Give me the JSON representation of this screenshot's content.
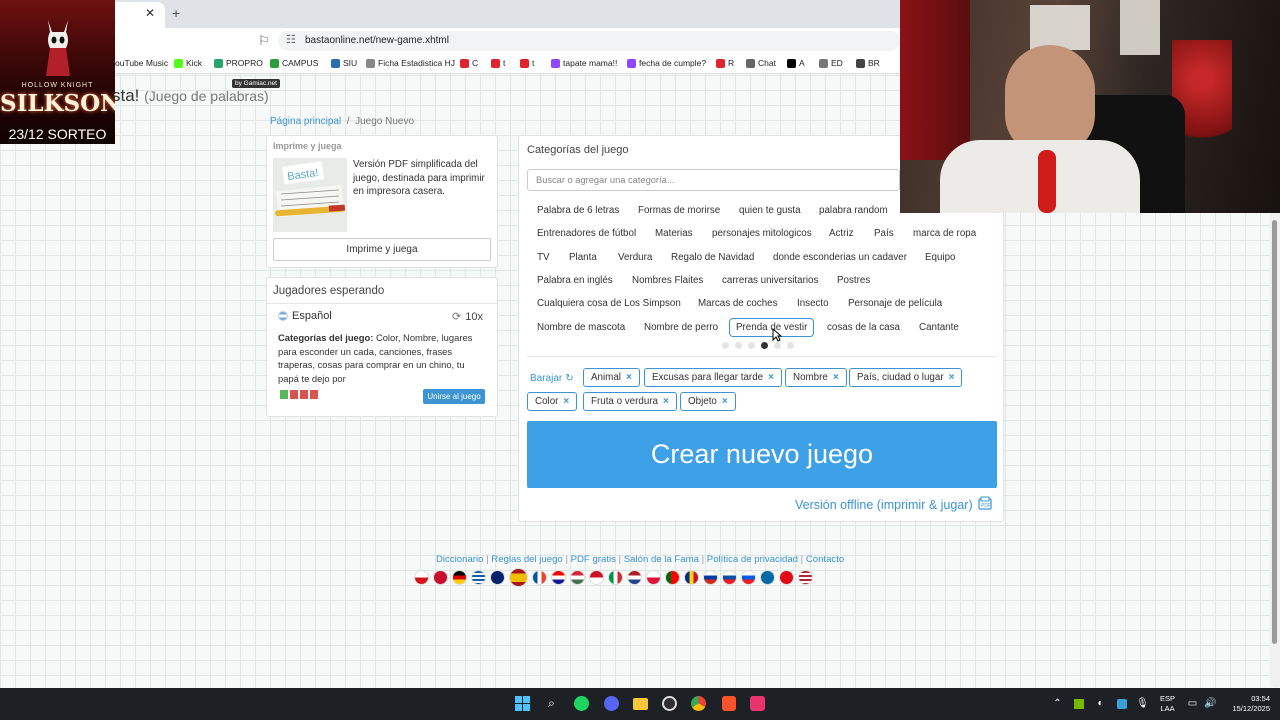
{
  "browser": {
    "url": "bastaonline.net/new-game.xhtml",
    "bookmarks": [
      {
        "label": "ouTube Music",
        "color": "#ff0000"
      },
      {
        "label": "Kick",
        "color": "#53fc18"
      },
      {
        "label": "PROPRO",
        "color": "#2aa56a"
      },
      {
        "label": "CAMPUS",
        "color": "#2e9b3b"
      },
      {
        "label": "SIU",
        "color": "#2d6cb5"
      },
      {
        "label": "Ficha Estadistica HJ",
        "color": "#888888"
      },
      {
        "label": "C",
        "color": "#e0242b"
      },
      {
        "label": "t",
        "color": "#e0242b"
      },
      {
        "label": "t",
        "color": "#e0242b"
      },
      {
        "label": "tapate mama!!",
        "color": "#9146ff"
      },
      {
        "label": "fecha de cumple?",
        "color": "#9146ff"
      },
      {
        "label": "R",
        "color": "#e0242b"
      },
      {
        "label": "Chat",
        "color": "#666666"
      },
      {
        "label": "A",
        "color": "#000000"
      },
      {
        "label": "ED",
        "color": "#777777"
      },
      {
        "label": "BR",
        "color": "#444444"
      }
    ]
  },
  "overlay": {
    "hk_small": "HOLLOW KNIGHT",
    "game_title": "SILKSONG",
    "promo": "23/12 SORTEO",
    "badge": "by Gamiac.net"
  },
  "page": {
    "title": "sta!",
    "title_sub": "(Juego de palabras)",
    "breadcrumb": {
      "home": "Página principal",
      "separator": "/",
      "current": "Juego Nuevo"
    }
  },
  "print_panel": {
    "heading": "Imprime y juega",
    "description": "Versión PDF simplificada del juego, destinada para imprimir en impresora casera.",
    "button": "Imprime y juega"
  },
  "waiting_panel": {
    "heading": "Jugadores esperando",
    "language": "Español",
    "rounds": "10x",
    "categories_label": "Categorías del juego:",
    "categories": "Color, Nombre, lugares para esconder un cada, canciones, frases traperas, cosas para comprar en un chino, tu papá te dejo por",
    "join_button": "Unirse al juego"
  },
  "category_panel": {
    "heading": "Categorías del juego",
    "search_placeholder": "Buscar o agregar una categoría...",
    "suggestions": [
      "Palabra de 6 letras",
      "Formas de morirse",
      "quien te gusta",
      "palabra random",
      "Entrenadores de fútbol",
      "Materias",
      "personajes mitologicos",
      "Actriz",
      "País",
      "marca de ropa",
      "TV",
      "Planta",
      "Verdura",
      "Regalo de Navidad",
      "donde esconderias un cadaver",
      "Equipo",
      "Palabra en inglés",
      "Nombres Flaites",
      "carreras universitarios",
      "Postres",
      "Cualquiera cosa de Los Simpson",
      "Marcas de coches",
      "Insecto",
      "Personaje de película",
      "Nombre de mascota",
      "Nombre de perro",
      "Prenda de vestir",
      "cosas de la casa",
      "Cantante"
    ],
    "highlighted": "Prenda de vestir",
    "page_count": 6,
    "current_page": 4,
    "shuffle": "Barajar",
    "selected": [
      "Animal",
      "Excusas para llegar tarde",
      "Nombre",
      "País, ciudad o lugar",
      "Color",
      "Fruta o verdura",
      "Objeto"
    ],
    "create_button": "Crear nuevo juego",
    "offline_link": "Versión offline (imprimir & jugar)"
  },
  "footer": {
    "links": [
      "Diccionario",
      "Reglas del juego",
      "PDF gratis",
      "Salón de la Fama",
      "Política de privacidad",
      "Contacto"
    ],
    "flags": [
      "cz",
      "dk",
      "de",
      "gr",
      "gb",
      "es",
      "fr",
      "hr",
      "hu",
      "id",
      "it",
      "nl",
      "pl",
      "pt",
      "ro",
      "ru",
      "sk",
      "si",
      "se",
      "tr",
      "us"
    ],
    "active_flag": "es"
  },
  "taskbar": {
    "lang": "ESP",
    "layout": "LAA",
    "time": "03:54",
    "date": "15/12/2025"
  }
}
